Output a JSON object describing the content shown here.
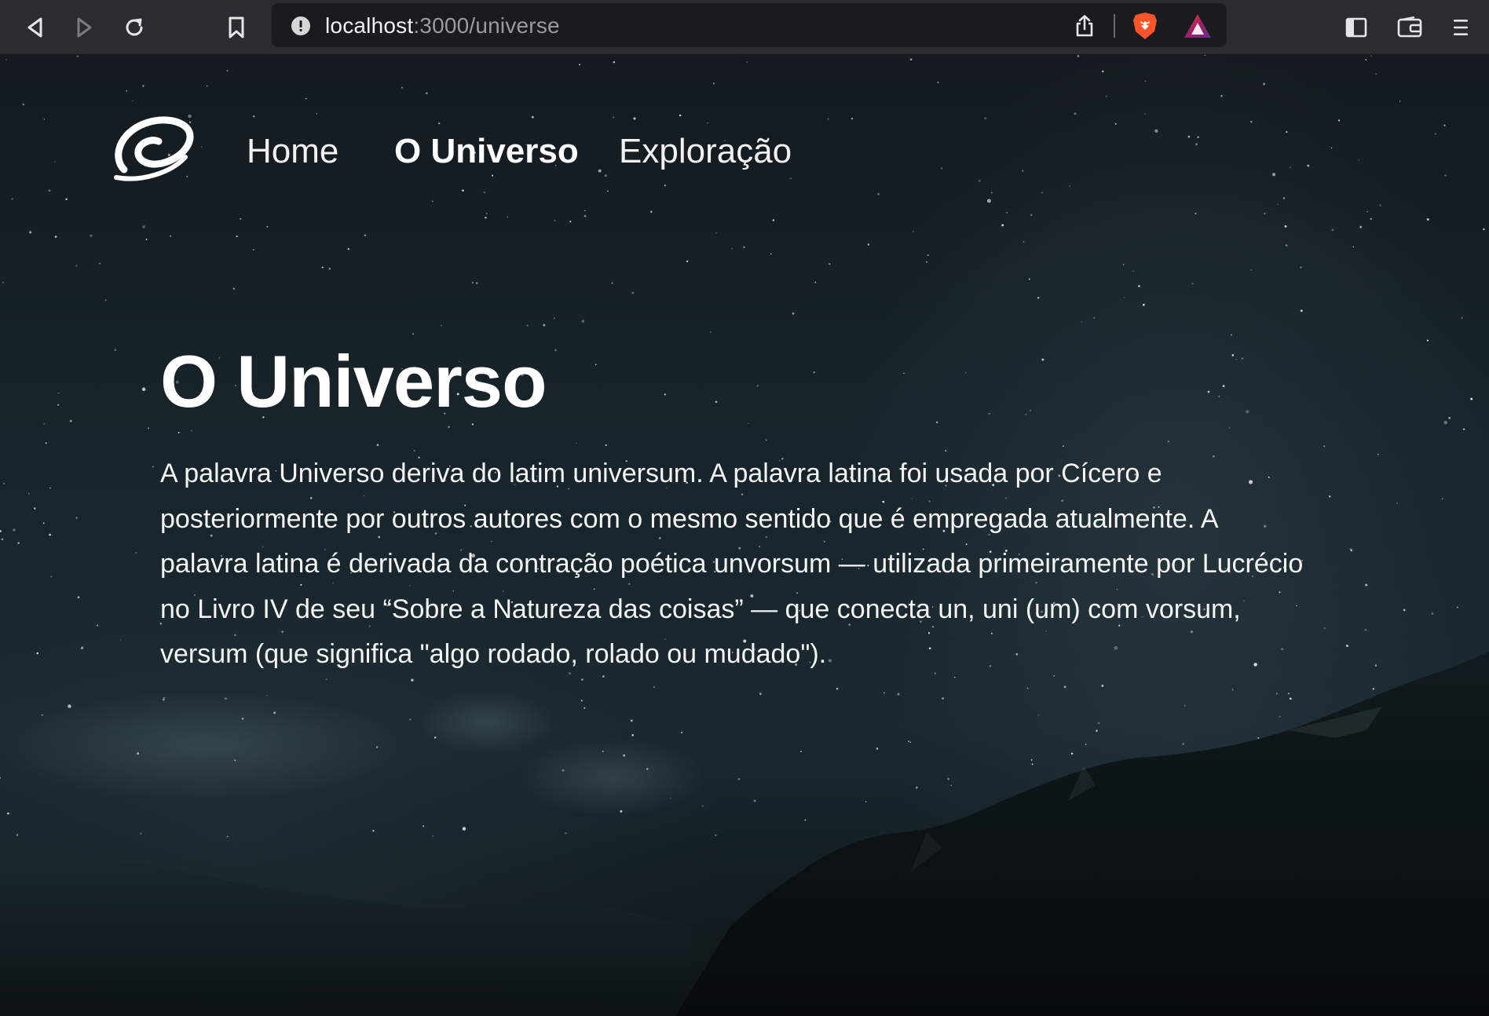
{
  "browser": {
    "url_host": "localhost",
    "url_rest": ":3000/universe"
  },
  "icons": {
    "back": "back-arrow-icon",
    "forward": "forward-arrow-icon",
    "reload": "reload-icon",
    "bookmark": "bookmark-icon",
    "site_info": "info-icon",
    "share": "share-icon",
    "shields": "brave-shields-icon",
    "rewards": "brave-rewards-icon",
    "sidebar": "sidebar-icon",
    "wallet": "wallet-icon",
    "menu": "menu-icon",
    "logo": "swirl-logo-icon"
  },
  "nav": {
    "items": [
      {
        "label": "Home",
        "active": false
      },
      {
        "label": "O Universo",
        "active": true
      },
      {
        "label": "Exploração",
        "active": false
      }
    ]
  },
  "main": {
    "title": "O Universo",
    "paragraph": "A palavra Universo deriva do latim universum. A palavra latina foi usada por Cícero e posteriormente por outros autores com o mesmo sentido que é empregada atualmente. A palavra latina é derivada da contração poética unvorsum — utilizada primeiramente por Lucrécio no Livro IV de seu “Sobre a Natureza das coisas” — que conecta un, uni (um) com vorsum, versum (que significa \"algo rodado, rolado ou mudado\")."
  },
  "colors": {
    "chrome_bg": "#2b2c31",
    "urlbar_bg": "#1a1b1f",
    "page_text": "#ffffff",
    "shield_orange": "#fb542b"
  }
}
